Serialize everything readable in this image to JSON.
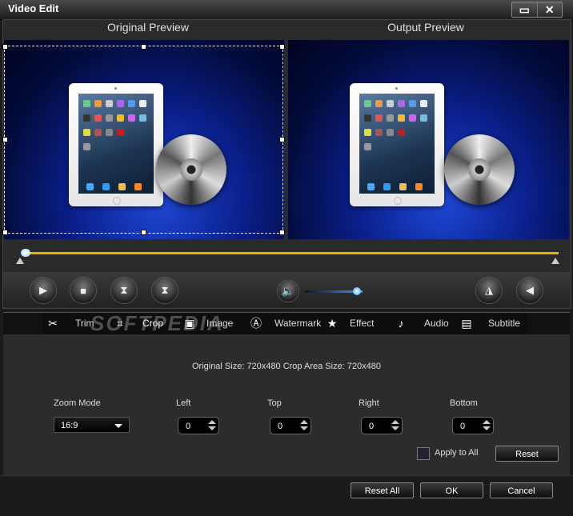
{
  "window": {
    "title": "Video Edit",
    "restore_icon": "restore-icon",
    "close_icon": "close-icon"
  },
  "preview": {
    "original_label": "Original Preview",
    "output_label": "Output Preview"
  },
  "playback": {
    "play_icon": "play-icon",
    "stop_icon": "stop-icon",
    "mark_in_icon": "mark-in-icon",
    "mark_out_icon": "mark-out-icon",
    "volume_icon": "speaker-icon",
    "volume_level": 0.9,
    "flip_horizontal_icon": "flip-horizontal-icon",
    "flip_vertical_icon": "flip-vertical-icon"
  },
  "tabs": [
    {
      "label": "Trim",
      "icon": "scissors-icon"
    },
    {
      "label": "Crop",
      "icon": "crop-icon"
    },
    {
      "label": "Image",
      "icon": "image-icon"
    },
    {
      "label": "Watermark",
      "icon": "watermark-icon"
    },
    {
      "label": "Effect",
      "icon": "star-icon"
    },
    {
      "label": "Audio",
      "icon": "music-note-icon"
    },
    {
      "label": "Subtitle",
      "icon": "subtitle-icon"
    }
  ],
  "active_tab": "Crop",
  "crop": {
    "info": "Original Size: 720x480  Crop Area Size: 720x480",
    "zoom_mode_label": "Zoom Mode",
    "zoom_mode_value": "16:9",
    "left_label": "Left",
    "left_value": "0",
    "top_label": "Top",
    "top_value": "0",
    "right_label": "Right",
    "right_value": "0",
    "bottom_label": "Bottom",
    "bottom_value": "0",
    "apply_all_label": "Apply to All",
    "reset_label": "Reset"
  },
  "footer": {
    "reset_all_label": "Reset All",
    "ok_label": "OK",
    "cancel_label": "Cancel"
  },
  "watermark_text": "SOFTPEDIA"
}
